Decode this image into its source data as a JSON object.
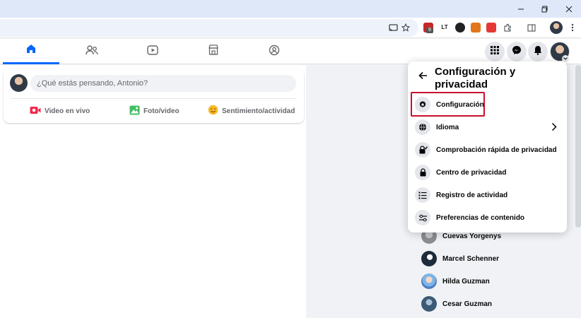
{
  "colors": {
    "accent": "#0866ff",
    "highlight": "#c8102e"
  },
  "browser": {
    "window_controls": [
      "minimize-icon",
      "restore-icon",
      "close-icon"
    ],
    "toolbar_icons": [
      "cast-icon",
      "bookmark-star-icon",
      "extension-icon",
      "extensions-puzzle-icon",
      "side-panel-icon",
      "profile-avatar",
      "more-menu-icon"
    ],
    "extension_badge": "9"
  },
  "nav": {
    "tabs": [
      {
        "icon": "home-icon",
        "active": true
      },
      {
        "icon": "friends-icon",
        "active": false
      },
      {
        "icon": "video-icon",
        "active": false
      },
      {
        "icon": "marketplace-icon",
        "active": false
      },
      {
        "icon": "groups-icon",
        "active": false
      }
    ],
    "right": [
      "menu-grid-icon",
      "messenger-icon",
      "notifications-icon",
      "account-avatar"
    ]
  },
  "composer": {
    "placeholder": "¿Qué estás pensando, Antonio?",
    "actions": [
      {
        "label": "Video en vivo",
        "icon": "live-video-icon"
      },
      {
        "label": "Foto/video",
        "icon": "photo-icon"
      },
      {
        "label": "Sentimiento/actividad",
        "icon": "feeling-icon"
      }
    ]
  },
  "settings_menu": {
    "title": "Configuración y privacidad",
    "items": [
      {
        "label": "Configuración",
        "icon": "gear-icon",
        "highlighted": true
      },
      {
        "label": "Idioma",
        "icon": "globe-icon",
        "has_submenu": true
      },
      {
        "label": "Comprobación rápida de privacidad",
        "icon": "lock-check-icon"
      },
      {
        "label": "Centro de privacidad",
        "icon": "lock-icon"
      },
      {
        "label": "Registro de actividad",
        "icon": "list-icon"
      },
      {
        "label": "Preferencias de contenido",
        "icon": "sliders-icon"
      }
    ]
  },
  "contacts": [
    {
      "name": "Cuevas Yorgenys"
    },
    {
      "name": "Marcel Schenner"
    },
    {
      "name": "Hilda Guzman"
    },
    {
      "name": "Cesar Guzman"
    }
  ]
}
